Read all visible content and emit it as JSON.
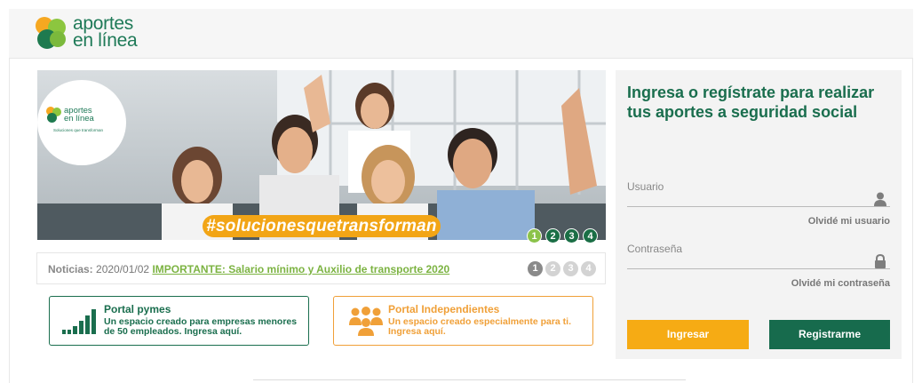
{
  "header": {
    "logo_text_line1": "aportes",
    "logo_text_line2": "en línea"
  },
  "banner": {
    "badge_text_line1": "aportes",
    "badge_text_line2": "en línea",
    "badge_tagline": "Soluciones que transforman",
    "hashtag": "#solucionesquetransforman",
    "slides": [
      "1",
      "2",
      "3",
      "4"
    ],
    "active_slide": "1"
  },
  "news": {
    "label": "Noticias:",
    "date": "2020/01/02",
    "link": "IMPORTANTE: Salario mínimo y Auxilio de transporte 2020",
    "pages": [
      "1",
      "2",
      "3",
      "4"
    ],
    "active_page": "1"
  },
  "portals": {
    "pymes": {
      "title": "Portal pymes",
      "description": "Un espacio creado para empresas menores de 50 empleados. Ingresa aquí."
    },
    "independientes": {
      "title": "Portal Independientes",
      "description": "Un espacio creado especialmente para ti. Ingresa aquí."
    }
  },
  "login": {
    "title": "Ingresa o regístrate para realizar tus aportes a seguridad social",
    "user_label": "Usuario",
    "user_value": "",
    "forgot_user": "Olvidé mi usuario",
    "password_label": "Contraseña",
    "password_value": "",
    "forgot_password": "Olvidé mi contraseña",
    "login_button": "Ingresar",
    "register_button": "Registrarme"
  },
  "colors": {
    "brand_green": "#1a6e4e",
    "brand_orange": "#f6ab14",
    "accent_lightgreen": "#8bc34a"
  }
}
